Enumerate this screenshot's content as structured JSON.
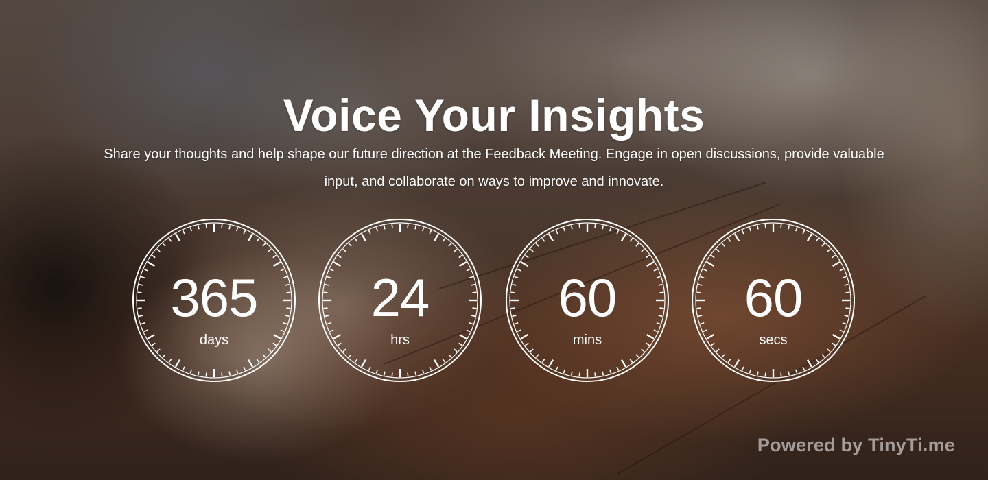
{
  "header": {
    "title": "Voice Your Insights",
    "subtitle": "Share your thoughts and help shape our future direction at the Feedback Meeting. Engage in open discussions, provide valuable input, and collaborate on ways to improve and innovate."
  },
  "countdown": {
    "days": {
      "value": "365",
      "unit": "days"
    },
    "hours": {
      "value": "24",
      "unit": "hrs"
    },
    "minutes": {
      "value": "60",
      "unit": "mins"
    },
    "seconds": {
      "value": "60",
      "unit": "secs"
    }
  },
  "footer": {
    "powered_by": "Powered by TinyTi.me"
  },
  "colors": {
    "text": "#ffffff",
    "powered_text": "#bfb7b3"
  }
}
